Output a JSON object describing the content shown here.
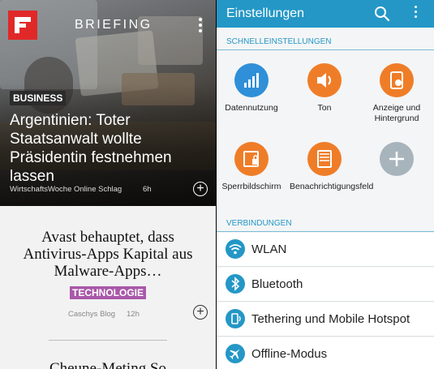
{
  "briefing": {
    "title": "BRIEFING",
    "hero": {
      "tag": "BUSINESS",
      "headline": "Argentinien: Toter Staatsanwalt wollte Präsidentin festnehmen lassen",
      "source": "WirtschaftsWoche Online Schlag",
      "time": "6h"
    },
    "card2": {
      "headline": "Avast behauptet, dass Antivirus-Apps Kapital aus Malware-Apps…",
      "tag": "TECHNOLOGIE",
      "source": "Caschys Blog",
      "time": "12h"
    },
    "card3": {
      "headline": "Cheune-Meting So"
    },
    "colors": {
      "logo": "#e12828",
      "tag_tech": "#a958a9"
    }
  },
  "settings": {
    "title": "Einstellungen",
    "quick_section": "SCHNELLEINSTELLUNGEN",
    "quick_items": [
      {
        "label": "Datennutzung",
        "icon": "bar-chart-icon",
        "color": "#2f8fd8"
      },
      {
        "label": "Ton",
        "icon": "speaker-icon",
        "color": "#ef7d28"
      },
      {
        "label": "Anzeige und Hintergrund",
        "icon": "display-icon",
        "color": "#ef7d28"
      },
      {
        "label": "Sperrbildschirm",
        "icon": "lock-screen-icon",
        "color": "#ef7d28"
      },
      {
        "label": "Benachrichtigungsfeld",
        "icon": "notification-panel-icon",
        "color": "#ef7d28"
      },
      {
        "label": "",
        "icon": "plus-icon",
        "color": "#a8b4bc"
      }
    ],
    "connections_section": "VERBINDUNGEN",
    "connections": [
      {
        "label": "WLAN",
        "icon": "wifi-icon"
      },
      {
        "label": "Bluetooth",
        "icon": "bluetooth-icon"
      },
      {
        "label": "Tethering und Mobile Hotspot",
        "icon": "hotspot-icon"
      },
      {
        "label": "Offline-Modus",
        "icon": "airplane-icon"
      }
    ],
    "colors": {
      "accent": "#2497c6"
    }
  }
}
